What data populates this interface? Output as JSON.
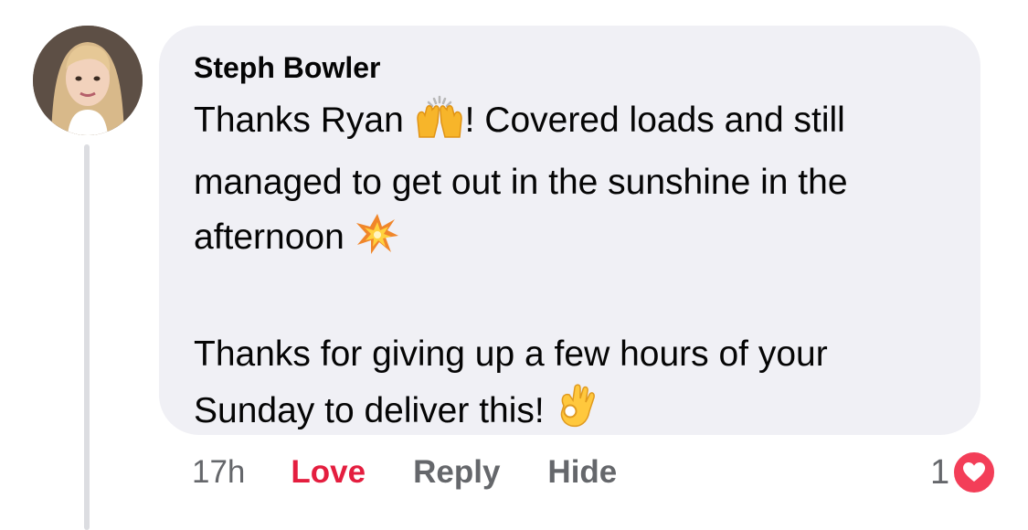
{
  "comment": {
    "author": "Steph Bowler",
    "line1_before": "Thanks Ryan ",
    "line1_after": "! Covered loads and still managed to get out in the sunshine in the afternoon ",
    "line2": "Thanks for giving up a few hours of your Sunday to deliver this! ",
    "emojis": [
      "raising-hands-icon",
      "collision-icon",
      "ok-hand-icon"
    ]
  },
  "actions": {
    "time": "17h",
    "love": "Love",
    "reply": "Reply",
    "hide": "Hide"
  },
  "reactions": {
    "count": "1",
    "type": "heart-icon"
  },
  "colors": {
    "bubble": "#f0f0f5",
    "love": "#e41e3f",
    "heart_badge": "#f33e58",
    "muted": "#65676b"
  }
}
